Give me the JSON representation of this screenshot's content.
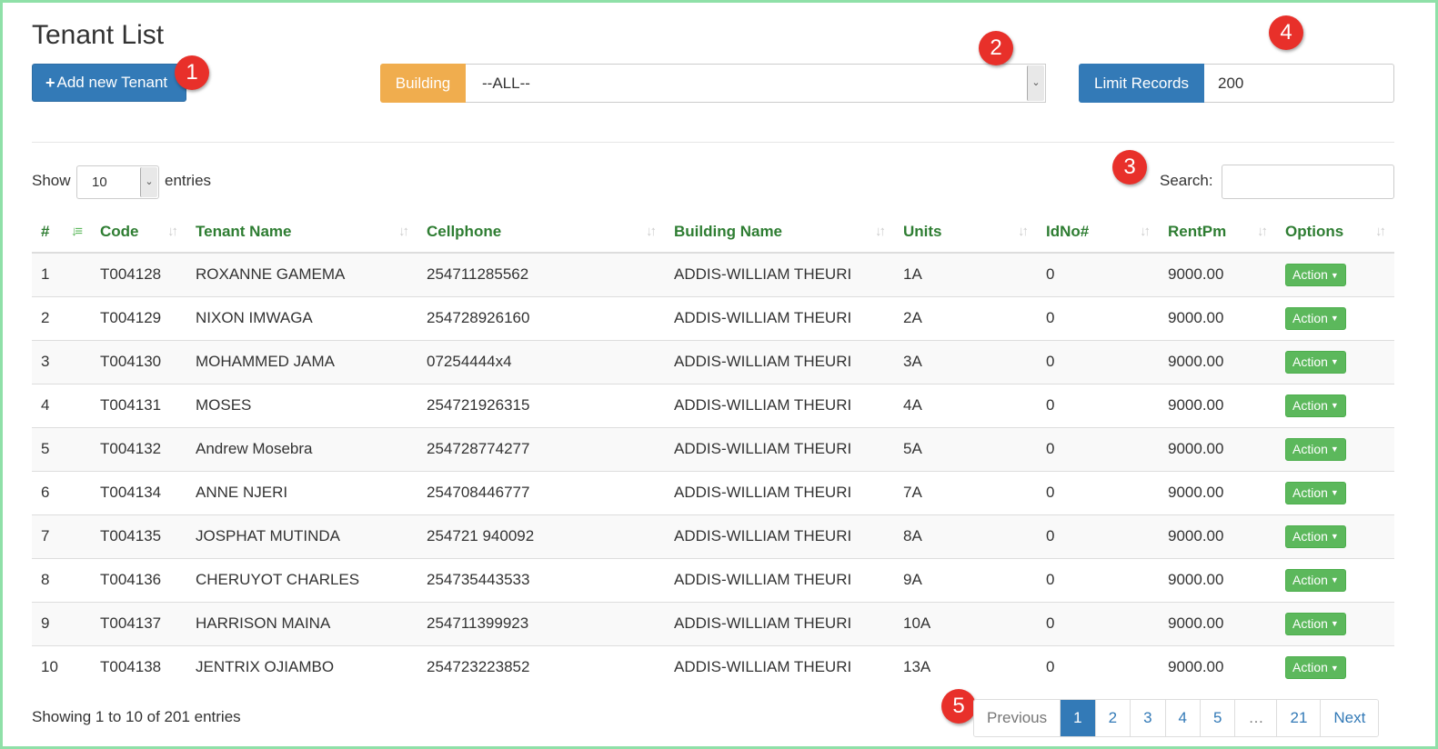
{
  "header": {
    "title": "Tenant List",
    "add_button": "Add new Tenant",
    "building_label": "Building",
    "building_value": "--ALL--",
    "limit_label": "Limit Records",
    "limit_value": "200"
  },
  "controls": {
    "show_label": "Show",
    "page_length": "10",
    "entries_label": "entries",
    "search_label": "Search:",
    "search_value": ""
  },
  "badges": [
    "1",
    "2",
    "3",
    "4",
    "5"
  ],
  "table": {
    "columns": [
      "#",
      "Code",
      "Tenant Name",
      "Cellphone",
      "Building Name",
      "Units",
      "IdNo#",
      "RentPm",
      "Options"
    ],
    "rows": [
      [
        "1",
        "T004128",
        "ROXANNE GAMEMA",
        "254711285562",
        "ADDIS-WILLIAM THEURI",
        "1A",
        "0",
        "9000.00",
        "Action"
      ],
      [
        "2",
        "T004129",
        "NIXON IMWAGA",
        "254728926160",
        "ADDIS-WILLIAM THEURI",
        "2A",
        "0",
        "9000.00",
        "Action"
      ],
      [
        "3",
        "T004130",
        "MOHAMMED JAMA",
        "07254444x4",
        "ADDIS-WILLIAM THEURI",
        "3A",
        "0",
        "9000.00",
        "Action"
      ],
      [
        "4",
        "T004131",
        "MOSES",
        "254721926315",
        "ADDIS-WILLIAM THEURI",
        "4A",
        "0",
        "9000.00",
        "Action"
      ],
      [
        "5",
        "T004132",
        "Andrew Mosebra",
        "254728774277",
        "ADDIS-WILLIAM THEURI",
        "5A",
        "0",
        "9000.00",
        "Action"
      ],
      [
        "6",
        "T004134",
        "ANNE NJERI",
        "254708446777",
        "ADDIS-WILLIAM THEURI",
        "7A",
        "0",
        "9000.00",
        "Action"
      ],
      [
        "7",
        "T004135",
        "JOSPHAT MUTINDA",
        "254721 940092",
        "ADDIS-WILLIAM THEURI",
        "8A",
        "0",
        "9000.00",
        "Action"
      ],
      [
        "8",
        "T004136",
        "CHERUYOT CHARLES",
        "254735443533",
        "ADDIS-WILLIAM THEURI",
        "9A",
        "0",
        "9000.00",
        "Action"
      ],
      [
        "9",
        "T004137",
        "HARRISON MAINA",
        "254711399923",
        "ADDIS-WILLIAM THEURI",
        "10A",
        "0",
        "9000.00",
        "Action"
      ],
      [
        "10",
        "T004138",
        "JENTRIX OJIAMBO",
        "254723223852",
        "ADDIS-WILLIAM THEURI",
        "13A",
        "0",
        "9000.00",
        "Action"
      ]
    ]
  },
  "footer": {
    "info": "Showing 1 to 10 of 201 entries",
    "pages": [
      "Previous",
      "1",
      "2",
      "3",
      "4",
      "5",
      "…",
      "21",
      "Next"
    ],
    "active_page": "1"
  },
  "colors": {
    "primary": "#337ab7",
    "warning": "#f0ad4e",
    "success": "#5cb85c",
    "header_text": "#2e7d32",
    "badge": "#e8302a"
  }
}
